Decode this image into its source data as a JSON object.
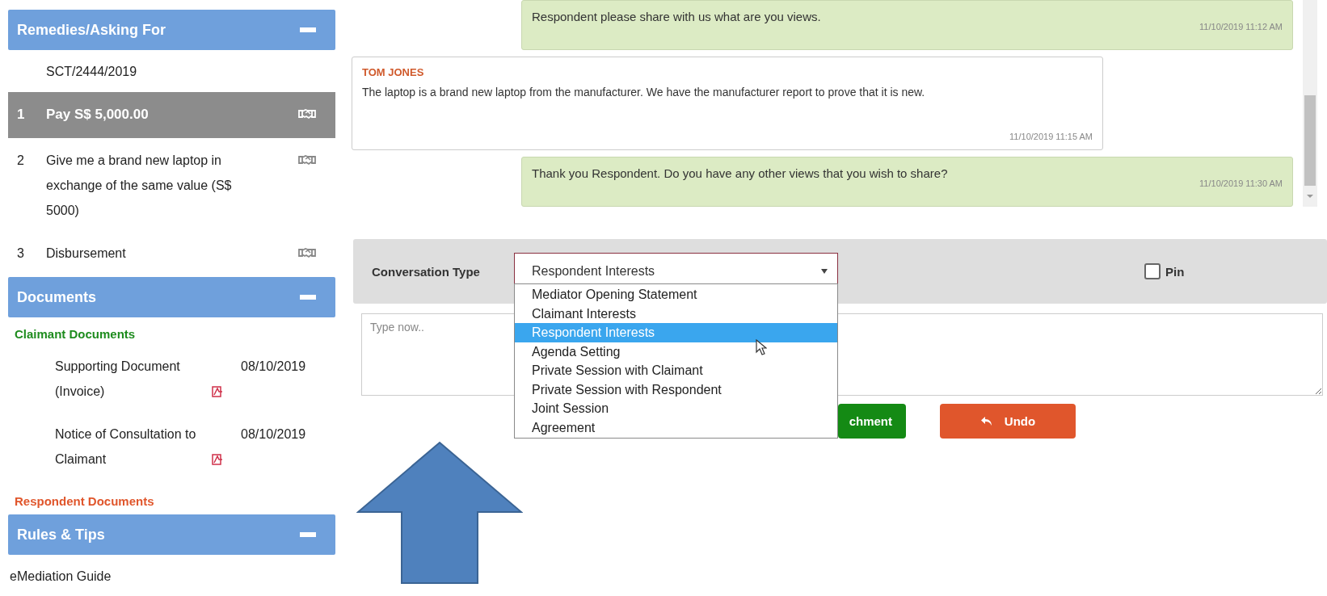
{
  "sidebar": {
    "panels": [
      {
        "kind": "remedies",
        "title": "Remedies/Asking For",
        "case_number": "SCT/2444/2019",
        "items": [
          {
            "number": "1",
            "text": "Pay S$ 5,000.00",
            "selected": true
          },
          {
            "number": "2",
            "text": "Give me a brand new laptop in exchange of the same value (S$ 5000)",
            "selected": false
          },
          {
            "number": "3",
            "text": "Disbursement",
            "selected": false
          }
        ]
      },
      {
        "kind": "documents",
        "title": "Documents",
        "groups": [
          {
            "title": "Claimant Documents",
            "color": "#1e8c1e",
            "documents": [
              {
                "name": "Supporting Document (Invoice)",
                "date": "08/10/2019"
              },
              {
                "name": "Notice of Consultation to Claimant",
                "date": "08/10/2019"
              }
            ]
          },
          {
            "title": "Respondent Documents",
            "color": "#e0562c"
          }
        ]
      },
      {
        "kind": "links",
        "title": "Rules & Tips",
        "links": [
          "eMediation Guide"
        ]
      }
    ]
  },
  "chat": {
    "messages": [
      {
        "kind": "sent",
        "text": "Respondent please share with us what are you views.",
        "time": "11/10/2019 11:12 AM"
      },
      {
        "kind": "received",
        "sender": "TOM JONES",
        "text": "The laptop is a brand new laptop from the manufacturer. We have the manufacturer report to prove that it is new.",
        "time": "11/10/2019 11:15 AM"
      },
      {
        "kind": "sent",
        "text": "Thank you Respondent. Do you have any other views that you wish to share?",
        "time": "11/10/2019 11:30 AM"
      }
    ]
  },
  "composer": {
    "type_label": "Conversation Type",
    "type_value": "Respondent Interests",
    "type_options": [
      {
        "label": "Mediator Opening Statement",
        "selected": false
      },
      {
        "label": "Claimant Interests",
        "selected": false
      },
      {
        "label": "Respondent Interests",
        "selected": true
      },
      {
        "label": "Agenda Setting",
        "selected": false
      },
      {
        "label": "Private Session with Claimant",
        "selected": false
      },
      {
        "label": "Private Session with Respondent",
        "selected": false
      },
      {
        "label": "Joint Session",
        "selected": false
      },
      {
        "label": "Agreement",
        "selected": false
      }
    ],
    "pin": {
      "label": "Pin",
      "checked": false
    },
    "message_placeholder": "Type now..",
    "buttons": [
      {
        "kind": "attach",
        "label": "chment"
      },
      {
        "kind": "undo",
        "label": "Undo"
      }
    ]
  }
}
